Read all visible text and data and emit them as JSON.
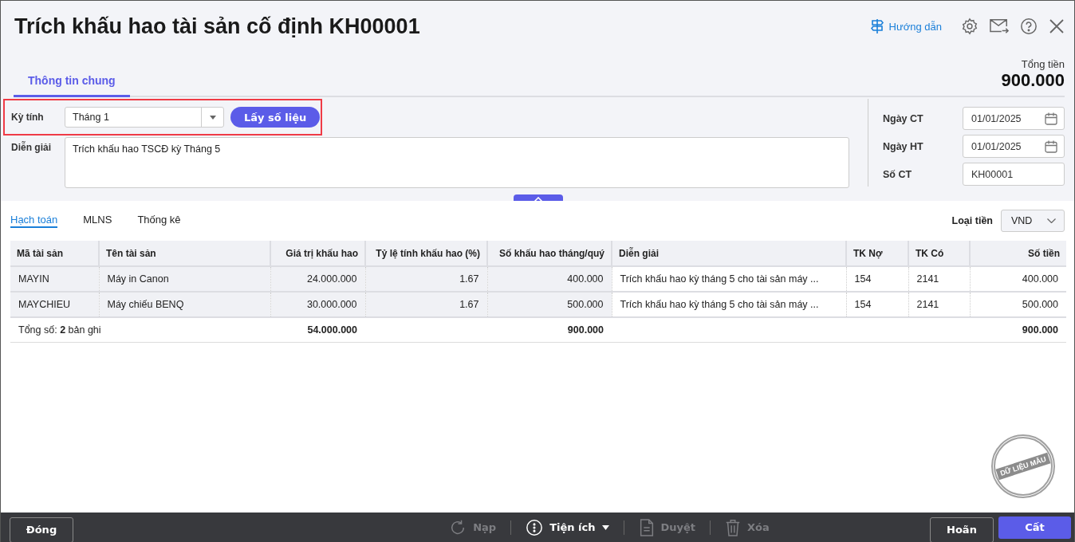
{
  "window": {
    "title": "Trích khấu hao tài sản cố định KH00001",
    "help_link": "Hướng dẫn"
  },
  "tabs": [
    {
      "label": "Thông tin chung",
      "selected": true
    }
  ],
  "total": {
    "label": "Tổng tiền",
    "value": "900.000"
  },
  "form": {
    "period": {
      "label": "Kỳ tính",
      "value": "Tháng 1",
      "highlighted": true
    },
    "fetch_button": "Lấy số liệu",
    "description": {
      "label": "Diễn giải",
      "value": "Trích khấu hao TSCĐ kỳ Tháng 5"
    },
    "right_fields": [
      {
        "label": "Ngày CT",
        "value": "01/01/2025",
        "kind": "date"
      },
      {
        "label": "Ngày HT",
        "value": "01/01/2025",
        "kind": "date"
      },
      {
        "label": "Số CT",
        "value": "KH00001",
        "kind": "text"
      }
    ]
  },
  "sub_tabs": [
    {
      "label": "Hạch toán",
      "selected": true
    },
    {
      "label": "MLNS",
      "selected": false
    },
    {
      "label": "Thống kê",
      "selected": false
    }
  ],
  "currency": {
    "label": "Loại tiền",
    "value": "VND"
  },
  "table": {
    "columns": [
      {
        "label": "Mã tài sản",
        "kind": "text",
        "readonly": true
      },
      {
        "label": "Tên tài sản",
        "kind": "text",
        "readonly": true
      },
      {
        "label": "Giá trị khấu hao",
        "kind": "number",
        "readonly": true,
        "total": "54.000.000"
      },
      {
        "label": "Tỷ lệ tính khấu hao (%)",
        "kind": "number",
        "readonly": true
      },
      {
        "label": "Số khấu hao tháng/quý",
        "kind": "number",
        "readonly": true,
        "total": "900.000"
      },
      {
        "label": "Diễn giải",
        "kind": "text",
        "readonly": false
      },
      {
        "label": "TK Nợ",
        "kind": "text",
        "readonly": false
      },
      {
        "label": "TK Có",
        "kind": "text",
        "readonly": false
      },
      {
        "label": "Số tiền",
        "kind": "number",
        "readonly": false,
        "total": "900.000"
      }
    ],
    "rows": [
      [
        "MAYIN",
        "Máy in Canon",
        "24.000.000",
        "1.67",
        "400.000",
        "Trích khấu hao kỳ tháng 5 cho tài sản máy ...",
        "154",
        "2141",
        "400.000"
      ],
      [
        "MAYCHIEU",
        "Máy chiếu BENQ",
        "30.000.000",
        "1.67",
        "500.000",
        "Trích khấu hao kỳ tháng 5 cho tài sản máy ...",
        "154",
        "2141",
        "500.000"
      ]
    ],
    "summary": "Tổng số: **2** bản ghi"
  },
  "stamp": "DỮ LIỆU MẪU",
  "footer": {
    "close": "Đóng",
    "tools": [
      {
        "label": "Nạp",
        "kind": "reload",
        "disabled": true
      },
      {
        "label": "Tiện ích",
        "kind": "utility",
        "disabled": false
      },
      {
        "label": "Duyệt",
        "kind": "approve",
        "disabled": true
      },
      {
        "label": "Xóa",
        "kind": "delete",
        "disabled": true
      }
    ],
    "cancel": "Hoãn",
    "save": "Cất"
  }
}
